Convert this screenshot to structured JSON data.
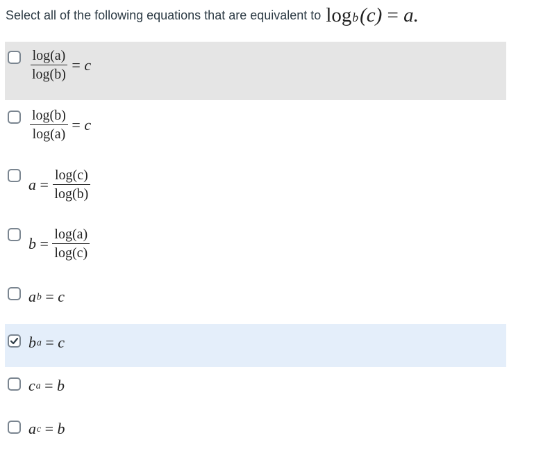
{
  "question": {
    "prompt": "Select all of the following equations that are equivalent to",
    "equation": {
      "log": "log",
      "base": "b",
      "arg": "(c)",
      "eq": "=",
      "rhs": "a."
    }
  },
  "options": [
    {
      "checked": false,
      "highlight": "hover",
      "num": "log(a)",
      "den": "log(b)",
      "rel": "=",
      "rhs": "c"
    },
    {
      "checked": false,
      "highlight": "none",
      "num": "log(b)",
      "den": "log(a)",
      "rel": "=",
      "rhs": "c"
    },
    {
      "checked": false,
      "highlight": "none",
      "lhs": "a",
      "rel": "=",
      "num": "log(c)",
      "den": "log(b)"
    },
    {
      "checked": false,
      "highlight": "none",
      "lhs": "b",
      "rel": "=",
      "num": "log(a)",
      "den": "log(c)"
    },
    {
      "checked": false,
      "highlight": "none",
      "base": "a",
      "exp": "b",
      "rel": "=",
      "rhs": "c"
    },
    {
      "checked": true,
      "highlight": "selected",
      "base": "b",
      "exp": "a",
      "rel": "=",
      "rhs": "c"
    },
    {
      "checked": false,
      "highlight": "none",
      "base": "c",
      "exp": "a",
      "rel": "=",
      "rhs": "b"
    },
    {
      "checked": false,
      "highlight": "none",
      "base": "a",
      "exp": "c",
      "rel": "=",
      "rhs": "b"
    }
  ],
  "colors": {
    "hover_bg": "#e5e5e5",
    "selected_bg": "#e4eefa",
    "checkbox_border": "#7a8590",
    "text": "#2d3b45"
  },
  "icons": {
    "check": "check-icon"
  }
}
